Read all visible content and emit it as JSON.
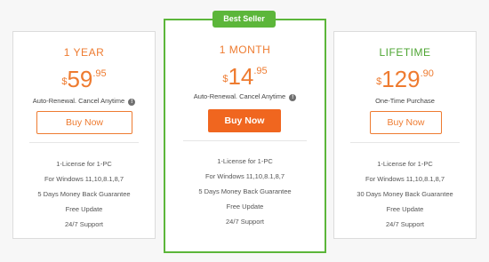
{
  "plans": [
    {
      "name": "1 YEAR",
      "currency": "$",
      "amount": "59",
      "cents": ".95",
      "subtitle": "Auto-Renewal. Cancel Anytime",
      "button": "Buy Now",
      "features": [
        "1-License for 1-PC",
        "For Windows 11,10,8.1,8,7",
        "5 Days Money Back Guarantee",
        "Free Update",
        "24/7 Support"
      ]
    },
    {
      "badge": "Best Seller",
      "name": "1 MONTH",
      "currency": "$",
      "amount": "14",
      "cents": ".95",
      "subtitle": "Auto-Renewal. Cancel Anytime",
      "button": "Buy Now",
      "features": [
        "1-License for 1-PC",
        "For Windows 11,10,8.1,8,7",
        "5 Days Money Back Guarantee",
        "Free Update",
        "24/7 Support"
      ]
    },
    {
      "name": "LIFETIME",
      "currency": "$",
      "amount": "129",
      "cents": ".90",
      "subtitle": "One-Time Purchase",
      "button": "Buy Now",
      "features": [
        "1-License for 1-PC",
        "For Windows 11,10,8.1,8,7",
        "30 Days Money Back Guarantee",
        "Free Update",
        "24/7 Support"
      ]
    }
  ],
  "icons": {
    "info": "info-icon"
  },
  "colors": {
    "accent": "#ee7b30",
    "button": "#f0661f",
    "highlight": "#5cb63a"
  }
}
